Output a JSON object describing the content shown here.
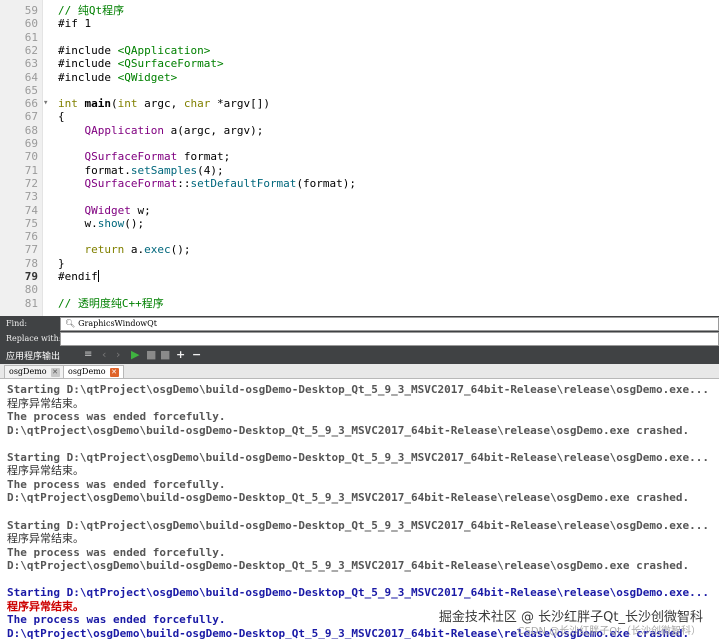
{
  "editor": {
    "lines": [
      {
        "n": "59",
        "code": "// 纯Qt程序"
      },
      {
        "n": "60",
        "code": "#if 1"
      },
      {
        "n": "61",
        "code": ""
      },
      {
        "n": "62",
        "code": "#include <QApplication>"
      },
      {
        "n": "63",
        "code": "#include <QSurfaceFormat>"
      },
      {
        "n": "64",
        "code": "#include <QWidget>"
      },
      {
        "n": "65",
        "code": ""
      },
      {
        "n": "66",
        "code": "int main(int argc, char *argv[])"
      },
      {
        "n": "67",
        "code": "{"
      },
      {
        "n": "68",
        "code": "    QApplication a(argc, argv);"
      },
      {
        "n": "69",
        "code": ""
      },
      {
        "n": "70",
        "code": "    QSurfaceFormat format;"
      },
      {
        "n": "71",
        "code": "    format.setSamples(4);"
      },
      {
        "n": "72",
        "code": "    QSurfaceFormat::setDefaultFormat(format);"
      },
      {
        "n": "73",
        "code": ""
      },
      {
        "n": "74",
        "code": "    QWidget w;"
      },
      {
        "n": "75",
        "code": "    w.show();"
      },
      {
        "n": "76",
        "code": ""
      },
      {
        "n": "77",
        "code": "    return a.exec();"
      },
      {
        "n": "78",
        "code": "}"
      },
      {
        "n": "79",
        "code": "#endif"
      },
      {
        "n": "80",
        "code": ""
      },
      {
        "n": "81",
        "code": "// 透明度纯C++程序"
      }
    ]
  },
  "findbar": {
    "find_label": "Find:",
    "find_value": "GraphicsWindowQt",
    "replace_label": "Replace with:",
    "replace_value": ""
  },
  "output_pane": {
    "title": "应用程序输出",
    "tabs": [
      {
        "label": "osgDemo"
      },
      {
        "label": "osgDemo"
      }
    ],
    "lines": [
      {
        "text": "Starting D:\\qtProject\\osgDemo\\build-osgDemo-Desktop_Qt_5_9_3_MSVC2017_64bit-Release\\release\\osgDemo.exe...",
        "style": "gray"
      },
      {
        "text": "程序异常结束。",
        "style": "cn"
      },
      {
        "text": "The process was ended forcefully.",
        "style": "gray"
      },
      {
        "text": "D:\\qtProject\\osgDemo\\build-osgDemo-Desktop_Qt_5_9_3_MSVC2017_64bit-Release\\release\\osgDemo.exe crashed.",
        "style": "gray"
      },
      {
        "text": "",
        "style": "gray"
      },
      {
        "text": "Starting D:\\qtProject\\osgDemo\\build-osgDemo-Desktop_Qt_5_9_3_MSVC2017_64bit-Release\\release\\osgDemo.exe...",
        "style": "gray"
      },
      {
        "text": "程序异常结束。",
        "style": "cn"
      },
      {
        "text": "The process was ended forcefully.",
        "style": "gray"
      },
      {
        "text": "D:\\qtProject\\osgDemo\\build-osgDemo-Desktop_Qt_5_9_3_MSVC2017_64bit-Release\\release\\osgDemo.exe crashed.",
        "style": "gray"
      },
      {
        "text": "",
        "style": "gray"
      },
      {
        "text": "Starting D:\\qtProject\\osgDemo\\build-osgDemo-Desktop_Qt_5_9_3_MSVC2017_64bit-Release\\release\\osgDemo.exe...",
        "style": "gray"
      },
      {
        "text": "程序异常结束。",
        "style": "cn"
      },
      {
        "text": "The process was ended forcefully.",
        "style": "gray"
      },
      {
        "text": "D:\\qtProject\\osgDemo\\build-osgDemo-Desktop_Qt_5_9_3_MSVC2017_64bit-Release\\release\\osgDemo.exe crashed.",
        "style": "gray"
      },
      {
        "text": "",
        "style": "gray"
      },
      {
        "text": "Starting D:\\qtProject\\osgDemo\\build-osgDemo-Desktop_Qt_5_9_3_MSVC2017_64bit-Release\\release\\osgDemo.exe...",
        "style": "blue"
      },
      {
        "text": "程序异常结束。",
        "style": "cn-red"
      },
      {
        "text": "The process was ended forcefully.",
        "style": "blue"
      },
      {
        "text": "D:\\qtProject\\osgDemo\\build-osgDemo-Desktop_Qt_5_9_3_MSVC2017_64bit-Release\\release\\osgDemo.exe crashed.",
        "style": "blue"
      }
    ]
  },
  "watermark": {
    "line1": "掘金技术社区 @ 长沙红胖子Qt_长沙创微智科",
    "line2": "CSDN @长沙红胖子Qt（长沙创微智科）"
  },
  "colors": {
    "keyword": "#808000",
    "type": "#800080",
    "include": "#008000",
    "output_blue": "#1a1aa6",
    "output_red": "#cc0000",
    "close_active": "#e0642a"
  },
  "icons": [
    "filter-icon",
    "prev-icon",
    "next-icon",
    "run-icon",
    "stop-icon",
    "attach-icon",
    "zoom-in-icon",
    "zoom-out-icon",
    "search-icon",
    "close-icon"
  ]
}
